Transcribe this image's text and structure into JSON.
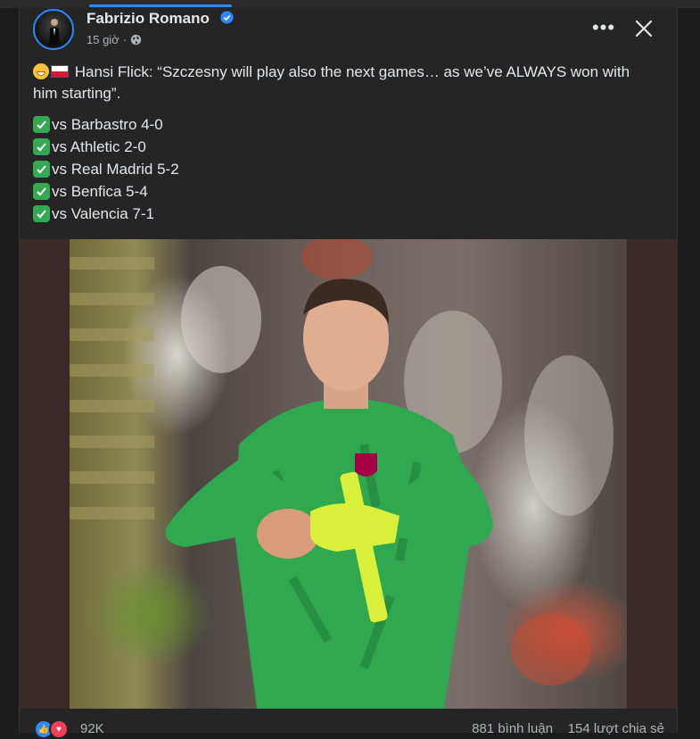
{
  "post": {
    "author": "Fabrizio Romano",
    "time": "15 giờ",
    "time_separator": "·",
    "quote": "Hansi Flick: “Szczesny will play also the next games… as we’ve ALWAYS won with him starting”.",
    "results": [
      "vs Barbastro 4-0",
      "vs Athletic 2-0",
      "vs Real Madrid 5-2",
      "vs Benfica 5-4",
      "vs Valencia 7-1"
    ]
  },
  "engagement": {
    "reactions": "92K",
    "comments": "881 bình luận",
    "shares": "154 lượt chia sẻ"
  },
  "icons": {
    "verified": "verified-badge-icon",
    "privacy": "globe-icon",
    "more": "more-options-icon",
    "close": "close-icon",
    "result_marker": "check-mark-icon"
  },
  "colors": {
    "accent": "#2d88ff",
    "check": "#35a853",
    "love": "#f33e58",
    "jersey": "#2fa84f",
    "gloves": "#d9f03a"
  }
}
